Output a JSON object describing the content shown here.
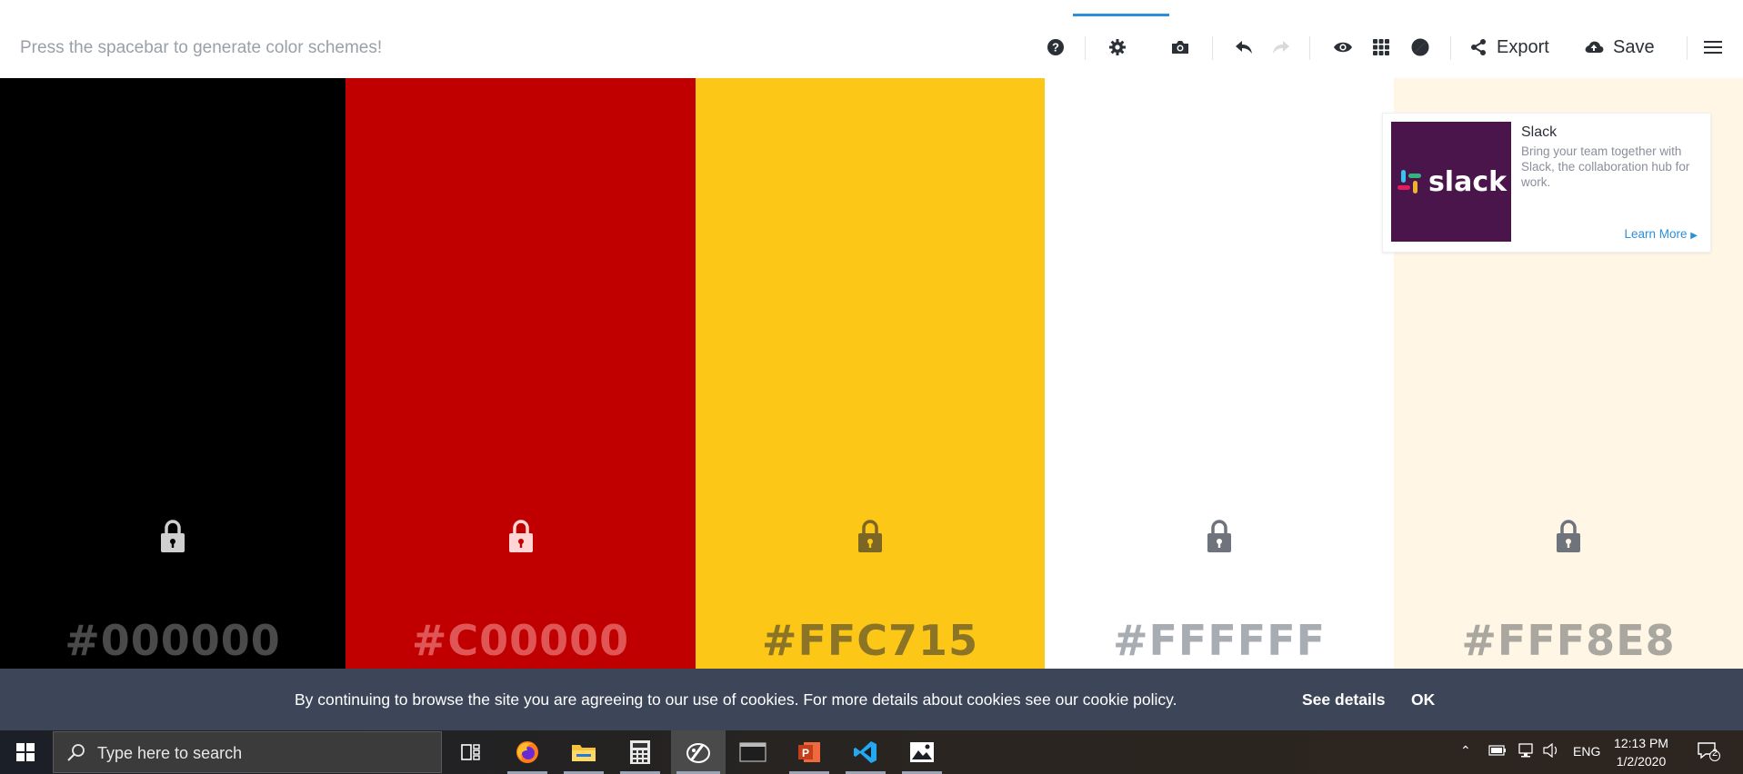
{
  "toolbar": {
    "hint": "Press the spacebar to generate color schemes!",
    "export_label": "Export",
    "save_label": "Save",
    "icons": [
      "help-icon",
      "settings-icon",
      "camera-icon",
      "undo-icon",
      "redo-icon",
      "eye-icon",
      "grid-icon",
      "contrast-icon",
      "share-icon",
      "cloud-upload-icon",
      "menu-icon"
    ]
  },
  "palette": {
    "colors": [
      {
        "hex": "#000000",
        "bg": "#000000",
        "text": "#4a4a4a",
        "lock": "#cfcfcf"
      },
      {
        "hex": "#C00000",
        "bg": "#c00000",
        "text": "#e05555",
        "lock": "#ffd5d5"
      },
      {
        "hex": "#FFC715",
        "bg": "#fcc717",
        "text": "#8c7427",
        "lock": "#7b6626"
      },
      {
        "hex": "#FFFFFF",
        "bg": "#ffffff",
        "text": "#a8acb3",
        "lock": "#6f747c"
      },
      {
        "hex": "#FFF8E8",
        "bg": "#fff6e6",
        "text": "#a9a79f",
        "lock": "#6f747c"
      }
    ]
  },
  "ad": {
    "logo_text": "slack",
    "title": "Slack",
    "description": "Bring your team together with Slack, the collaboration hub for work.",
    "cta": "Learn More"
  },
  "cookie": {
    "message": "By continuing to browse the site you are agreeing to our use of cookies. For more details about cookies see our cookie policy.",
    "details": "See details",
    "ok": "OK"
  },
  "taskbar": {
    "search_placeholder": "Type here to search",
    "apps": [
      "task-view-icon",
      "firefox-icon",
      "file-explorer-icon",
      "calculator-icon",
      "paint-icon",
      "terminal-icon",
      "powerpoint-icon",
      "vscode-icon",
      "photos-icon"
    ],
    "language": "ENG",
    "time": "12:13 PM",
    "date": "1/2/2020",
    "notification_count": "2"
  },
  "colors": {
    "accent": "#2b90d9",
    "cookie_bar": "#3d4558",
    "slack_purple": "#4a154b"
  }
}
